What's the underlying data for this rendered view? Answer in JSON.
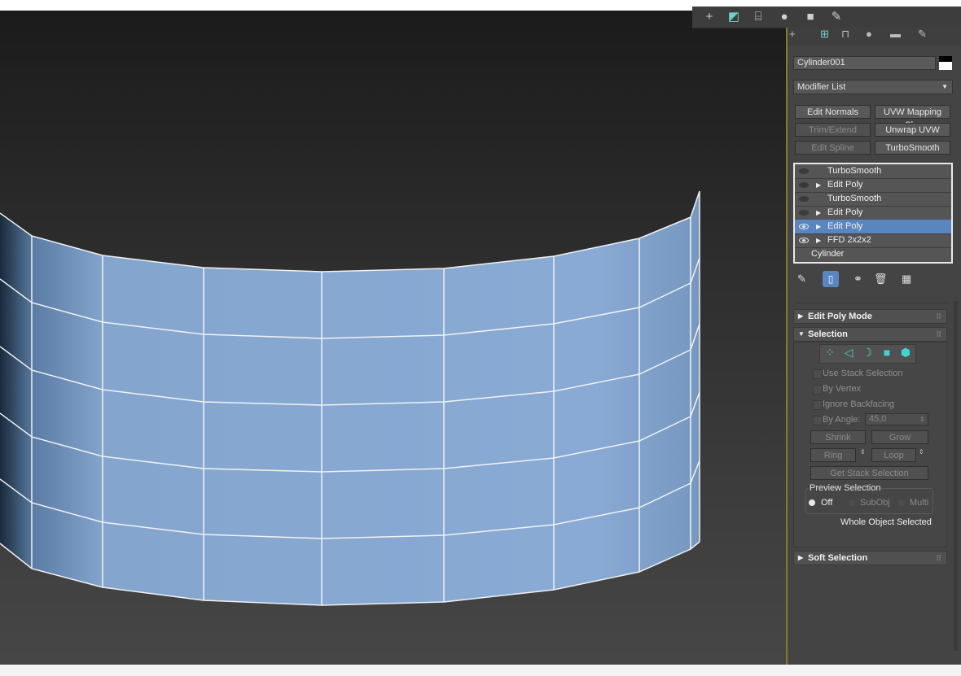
{
  "object_name": "Cylinder001",
  "modifier_list": {
    "label": "Modifier List"
  },
  "modifier_buttons": [
    "Edit Normals",
    "UVW Mapping Cl...",
    "Trim/Extend",
    "Unwrap UVW",
    "Edit Spline",
    "TurboSmooth"
  ],
  "stack": [
    {
      "label": "TurboSmooth",
      "eye": "off",
      "expand": false,
      "selected": false
    },
    {
      "label": "Edit Poly",
      "eye": "off",
      "expand": true,
      "selected": false
    },
    {
      "label": "TurboSmooth",
      "eye": "off",
      "expand": false,
      "selected": false
    },
    {
      "label": "Edit Poly",
      "eye": "off",
      "expand": true,
      "selected": false
    },
    {
      "label": "Edit Poly",
      "eye": "on",
      "expand": true,
      "selected": true
    },
    {
      "label": "FFD 2x2x2",
      "eye": "on",
      "expand": true,
      "selected": false
    },
    {
      "label": "Cylinder",
      "eye": "none",
      "expand": false,
      "selected": false
    }
  ],
  "rollouts": {
    "edit_poly_mode": "Edit Poly Mode",
    "selection": "Selection",
    "soft_selection": "Soft Selection"
  },
  "selection": {
    "use_stack": "Use Stack Selection",
    "by_vertex": "By Vertex",
    "ignore_backfacing": "Ignore Backfacing",
    "by_angle": "By Angle:",
    "angle_value": "45,0",
    "shrink": "Shrink",
    "grow": "Grow",
    "ring": "Ring",
    "loop": "Loop",
    "get_stack": "Get Stack Selection",
    "preview_title": "Preview Selection",
    "preview_off": "Off",
    "preview_subobj": "SubObj",
    "preview_multi": "Multi",
    "status": "Whole Object Selected"
  },
  "colors": {
    "selected_row": "#5a86c0",
    "mesh_fill": "#87a9d3",
    "accent_cyan": "#3fd2d6"
  }
}
